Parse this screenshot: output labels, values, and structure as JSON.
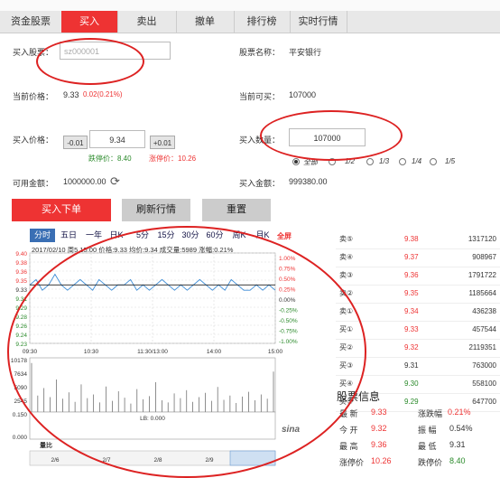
{
  "tabs": [
    {
      "label": "资金股票",
      "active": false
    },
    {
      "label": "买入",
      "active": true
    },
    {
      "label": "卖出",
      "active": false
    },
    {
      "label": "撤单",
      "active": false
    },
    {
      "label": "排行榜",
      "active": false
    },
    {
      "label": "实时行情",
      "active": false
    }
  ],
  "form": {
    "stock_code_label": "买入股票：",
    "stock_code_value": "sz000001",
    "stock_name_label": "股票名称：",
    "stock_name_value": "平安银行",
    "current_price_label": "当前价格：",
    "current_price_value": "9.33",
    "current_price_change": "0.02(0.21%)",
    "current_buyable_label": "当前可买：",
    "current_buyable_value": "107000",
    "buy_price_label": "买入价格：",
    "minus_label": "-0.01",
    "buy_price_value": "9.34",
    "plus_label": "+0.01",
    "limit_down_label": "跌停价：8.40",
    "limit_up_label": "涨停价：10.26",
    "buy_qty_label": "买入数量：",
    "buy_qty_value": "107000",
    "qty_options": [
      {
        "label": "全部",
        "selected": true
      },
      {
        "label": "1/2",
        "selected": false
      },
      {
        "label": "1/3",
        "selected": false
      },
      {
        "label": "1/4",
        "selected": false
      },
      {
        "label": "1/5",
        "selected": false
      }
    ],
    "available_label": "可用金额：",
    "available_value": "1000000.00",
    "buy_amount_label": "买入金额：",
    "buy_amount_value": "999380.00"
  },
  "actions": {
    "buy": "买入下单",
    "refresh": "刷新行情",
    "reset": "重置"
  },
  "chart_tabs": [
    {
      "label": "分时",
      "active": true
    },
    {
      "label": "五日",
      "active": false
    },
    {
      "label": "一年",
      "active": false
    },
    {
      "label": "日K",
      "active": false
    },
    {
      "label": "5分",
      "active": false
    },
    {
      "label": "15分",
      "active": false
    },
    {
      "label": "30分",
      "active": false
    },
    {
      "label": "60分",
      "active": false
    },
    {
      "label": "周K",
      "active": false
    },
    {
      "label": "月K",
      "active": false
    }
  ],
  "fullscreen_label": "全屏",
  "chart_header": "2017/02/10 周5 15:00 价格:9.33 均价:9.34 成交量:5989 涨幅:0.21%",
  "chart_data": {
    "type": "line",
    "x_ticks": [
      "09:30",
      "10:30",
      "11:30/13:00",
      "14:00",
      "15:00"
    ],
    "y_ticks_left": [
      "9.40",
      "9.38",
      "9.36",
      "9.35",
      "9.33",
      "9.31",
      "9.29",
      "9.28",
      "9.26",
      "9.24",
      "9.23"
    ],
    "y_ticks_right": [
      "1.00%",
      "0.75%",
      "0.50%",
      "0.25%",
      "0.00%",
      "-0.25%",
      "-0.50%",
      "-0.75%",
      "-1.00%"
    ],
    "volume_ticks": [
      "10178",
      "7634",
      "5090",
      "2545"
    ],
    "ylim": [
      9.23,
      9.4
    ],
    "series": [
      {
        "values": [
          9.34,
          9.35,
          9.33,
          9.34,
          9.36,
          9.34,
          9.33,
          9.34,
          9.35,
          9.34,
          9.33,
          9.35,
          9.34,
          9.33,
          9.34,
          9.34,
          9.35,
          9.33,
          9.34,
          9.33,
          9.34,
          9.35,
          9.34,
          9.33,
          9.34,
          9.33,
          9.34,
          9.35,
          9.34,
          9.33,
          9.34,
          9.33,
          9.35,
          9.34,
          9.33,
          9.33,
          9.34,
          9.33,
          9.34,
          9.33
        ]
      },
      {
        "values": [
          9.34,
          9.34,
          9.34,
          9.34,
          9.34,
          9.34,
          9.34,
          9.34,
          9.34,
          9.34,
          9.34,
          9.34,
          9.34,
          9.34,
          9.34,
          9.34,
          9.34,
          9.34,
          9.34,
          9.34,
          9.34,
          9.34,
          9.34,
          9.34,
          9.34,
          9.34,
          9.34,
          9.34,
          9.34,
          9.34,
          9.34,
          9.34,
          9.34,
          9.34,
          9.34,
          9.34,
          9.34,
          9.34,
          9.34,
          9.34
        ]
      }
    ],
    "volume": [
      9200,
      3100,
      4500,
      2800,
      6100,
      2500,
      3700,
      1900,
      5200,
      2600,
      3300,
      1800,
      4800,
      2100,
      3900,
      2700,
      1600,
      4300,
      2400,
      3000,
      5600,
      2200,
      1800,
      3500,
      2600,
      4100,
      1900,
      2800,
      3600,
      2100,
      4700,
      2300,
      3100,
      1700,
      2900,
      3800,
      2200,
      3300,
      2500,
      7600
    ],
    "lb_label": "LB: 0.000",
    "lb_ticks": [
      "0.150",
      "0.000"
    ],
    "bottom_label": "量比",
    "nav_dates": [
      "2/6",
      "2/7",
      "2/8",
      "2/9"
    ],
    "watermark": "sina"
  },
  "orderbook": [
    {
      "label": "卖⑤",
      "price": "9.38",
      "volume": "1317120"
    },
    {
      "label": "卖④",
      "price": "9.37",
      "volume": "908967"
    },
    {
      "label": "卖③",
      "price": "9.36",
      "volume": "1791722"
    },
    {
      "label": "卖②",
      "price": "9.35",
      "volume": "1185664"
    },
    {
      "label": "卖①",
      "price": "9.34",
      "volume": "436238"
    },
    {
      "label": "买①",
      "price": "9.33",
      "volume": "457544"
    },
    {
      "label": "买②",
      "price": "9.32",
      "volume": "2119351"
    },
    {
      "label": "买③",
      "price": "9.31",
      "volume": "763000"
    },
    {
      "label": "买④",
      "price": "9.30",
      "volume": "558100"
    },
    {
      "label": "买⑤",
      "price": "9.29",
      "volume": "647700"
    }
  ],
  "info": {
    "title": "股票信息",
    "latest_label": "最  新",
    "latest_value": "9.33",
    "change_label": "涨跌幅",
    "change_value": "0.21%",
    "open_label": "今  开",
    "open_value": "9.32",
    "amplitude_label": "振  幅",
    "amplitude_value": "0.54%",
    "high_label": "最  高",
    "high_value": "9.36",
    "low_label": "最  低",
    "low_value": "9.31",
    "limit_up_label": "涨停价",
    "limit_up_value": "10.26",
    "limit_down_label": "跌停价",
    "limit_down_value": "8.40"
  }
}
